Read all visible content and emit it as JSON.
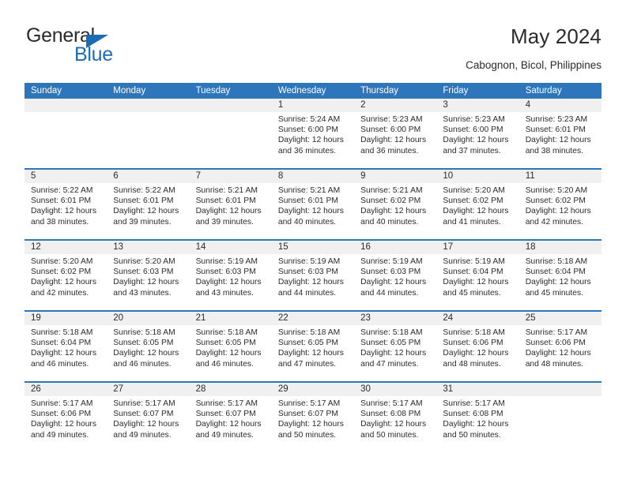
{
  "brand": {
    "name_part1": "General",
    "name_part2": "Blue",
    "accent_color": "#1c6cb5"
  },
  "header": {
    "title": "May 2024",
    "subtitle": "Cabognon, Bicol, Philippines"
  },
  "calendar": {
    "header_bg": "#2e76bc",
    "daynum_bg": "#f0f0f0",
    "weekdays": [
      "Sunday",
      "Monday",
      "Tuesday",
      "Wednesday",
      "Thursday",
      "Friday",
      "Saturday"
    ],
    "weeks": [
      [
        {
          "day": "",
          "lines": []
        },
        {
          "day": "",
          "lines": []
        },
        {
          "day": "",
          "lines": []
        },
        {
          "day": "1",
          "lines": [
            "Sunrise: 5:24 AM",
            "Sunset: 6:00 PM",
            "Daylight: 12 hours",
            "and 36 minutes."
          ]
        },
        {
          "day": "2",
          "lines": [
            "Sunrise: 5:23 AM",
            "Sunset: 6:00 PM",
            "Daylight: 12 hours",
            "and 36 minutes."
          ]
        },
        {
          "day": "3",
          "lines": [
            "Sunrise: 5:23 AM",
            "Sunset: 6:00 PM",
            "Daylight: 12 hours",
            "and 37 minutes."
          ]
        },
        {
          "day": "4",
          "lines": [
            "Sunrise: 5:23 AM",
            "Sunset: 6:01 PM",
            "Daylight: 12 hours",
            "and 38 minutes."
          ]
        }
      ],
      [
        {
          "day": "5",
          "lines": [
            "Sunrise: 5:22 AM",
            "Sunset: 6:01 PM",
            "Daylight: 12 hours",
            "and 38 minutes."
          ]
        },
        {
          "day": "6",
          "lines": [
            "Sunrise: 5:22 AM",
            "Sunset: 6:01 PM",
            "Daylight: 12 hours",
            "and 39 minutes."
          ]
        },
        {
          "day": "7",
          "lines": [
            "Sunrise: 5:21 AM",
            "Sunset: 6:01 PM",
            "Daylight: 12 hours",
            "and 39 minutes."
          ]
        },
        {
          "day": "8",
          "lines": [
            "Sunrise: 5:21 AM",
            "Sunset: 6:01 PM",
            "Daylight: 12 hours",
            "and 40 minutes."
          ]
        },
        {
          "day": "9",
          "lines": [
            "Sunrise: 5:21 AM",
            "Sunset: 6:02 PM",
            "Daylight: 12 hours",
            "and 40 minutes."
          ]
        },
        {
          "day": "10",
          "lines": [
            "Sunrise: 5:20 AM",
            "Sunset: 6:02 PM",
            "Daylight: 12 hours",
            "and 41 minutes."
          ]
        },
        {
          "day": "11",
          "lines": [
            "Sunrise: 5:20 AM",
            "Sunset: 6:02 PM",
            "Daylight: 12 hours",
            "and 42 minutes."
          ]
        }
      ],
      [
        {
          "day": "12",
          "lines": [
            "Sunrise: 5:20 AM",
            "Sunset: 6:02 PM",
            "Daylight: 12 hours",
            "and 42 minutes."
          ]
        },
        {
          "day": "13",
          "lines": [
            "Sunrise: 5:20 AM",
            "Sunset: 6:03 PM",
            "Daylight: 12 hours",
            "and 43 minutes."
          ]
        },
        {
          "day": "14",
          "lines": [
            "Sunrise: 5:19 AM",
            "Sunset: 6:03 PM",
            "Daylight: 12 hours",
            "and 43 minutes."
          ]
        },
        {
          "day": "15",
          "lines": [
            "Sunrise: 5:19 AM",
            "Sunset: 6:03 PM",
            "Daylight: 12 hours",
            "and 44 minutes."
          ]
        },
        {
          "day": "16",
          "lines": [
            "Sunrise: 5:19 AM",
            "Sunset: 6:03 PM",
            "Daylight: 12 hours",
            "and 44 minutes."
          ]
        },
        {
          "day": "17",
          "lines": [
            "Sunrise: 5:19 AM",
            "Sunset: 6:04 PM",
            "Daylight: 12 hours",
            "and 45 minutes."
          ]
        },
        {
          "day": "18",
          "lines": [
            "Sunrise: 5:18 AM",
            "Sunset: 6:04 PM",
            "Daylight: 12 hours",
            "and 45 minutes."
          ]
        }
      ],
      [
        {
          "day": "19",
          "lines": [
            "Sunrise: 5:18 AM",
            "Sunset: 6:04 PM",
            "Daylight: 12 hours",
            "and 46 minutes."
          ]
        },
        {
          "day": "20",
          "lines": [
            "Sunrise: 5:18 AM",
            "Sunset: 6:05 PM",
            "Daylight: 12 hours",
            "and 46 minutes."
          ]
        },
        {
          "day": "21",
          "lines": [
            "Sunrise: 5:18 AM",
            "Sunset: 6:05 PM",
            "Daylight: 12 hours",
            "and 46 minutes."
          ]
        },
        {
          "day": "22",
          "lines": [
            "Sunrise: 5:18 AM",
            "Sunset: 6:05 PM",
            "Daylight: 12 hours",
            "and 47 minutes."
          ]
        },
        {
          "day": "23",
          "lines": [
            "Sunrise: 5:18 AM",
            "Sunset: 6:05 PM",
            "Daylight: 12 hours",
            "and 47 minutes."
          ]
        },
        {
          "day": "24",
          "lines": [
            "Sunrise: 5:18 AM",
            "Sunset: 6:06 PM",
            "Daylight: 12 hours",
            "and 48 minutes."
          ]
        },
        {
          "day": "25",
          "lines": [
            "Sunrise: 5:17 AM",
            "Sunset: 6:06 PM",
            "Daylight: 12 hours",
            "and 48 minutes."
          ]
        }
      ],
      [
        {
          "day": "26",
          "lines": [
            "Sunrise: 5:17 AM",
            "Sunset: 6:06 PM",
            "Daylight: 12 hours",
            "and 49 minutes."
          ]
        },
        {
          "day": "27",
          "lines": [
            "Sunrise: 5:17 AM",
            "Sunset: 6:07 PM",
            "Daylight: 12 hours",
            "and 49 minutes."
          ]
        },
        {
          "day": "28",
          "lines": [
            "Sunrise: 5:17 AM",
            "Sunset: 6:07 PM",
            "Daylight: 12 hours",
            "and 49 minutes."
          ]
        },
        {
          "day": "29",
          "lines": [
            "Sunrise: 5:17 AM",
            "Sunset: 6:07 PM",
            "Daylight: 12 hours",
            "and 50 minutes."
          ]
        },
        {
          "day": "30",
          "lines": [
            "Sunrise: 5:17 AM",
            "Sunset: 6:08 PM",
            "Daylight: 12 hours",
            "and 50 minutes."
          ]
        },
        {
          "day": "31",
          "lines": [
            "Sunrise: 5:17 AM",
            "Sunset: 6:08 PM",
            "Daylight: 12 hours",
            "and 50 minutes."
          ]
        },
        {
          "day": "",
          "lines": []
        }
      ]
    ]
  }
}
